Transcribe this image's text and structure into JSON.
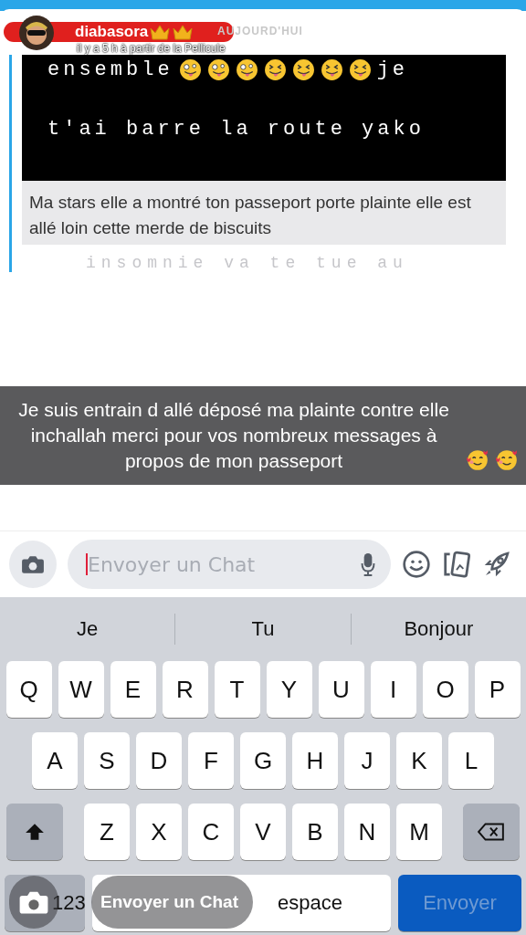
{
  "story_header": {
    "username": "diabasora",
    "date_label": "AUJOURD'HUI",
    "subtitle": "il y a 5 h à partir de la Pellicule"
  },
  "quoted_snap": {
    "line_1_start": "ensemble",
    "line_1_end": "je",
    "line_2": "t'ai barre la route yako",
    "caption": "Ma stars elle a montré ton passeport porte plainte elle est allé loin cette merde de biscuits",
    "faint_text": "insomnie va te tue au"
  },
  "banner": {
    "text": "Je suis entrain d allé déposé ma plainte contre elle inchallah merci pour vos nombreux messages à propos de mon passeport"
  },
  "chat_bar": {
    "placeholder": "Envoyer un Chat"
  },
  "keyboard": {
    "suggestions": [
      "Je",
      "Tu",
      "Bonjour"
    ],
    "rows": [
      [
        "Q",
        "W",
        "E",
        "R",
        "T",
        "Y",
        "U",
        "I",
        "O",
        "P"
      ],
      [
        "A",
        "S",
        "D",
        "F",
        "G",
        "H",
        "J",
        "K",
        "L"
      ],
      [
        "Z",
        "X",
        "C",
        "V",
        "B",
        "N",
        "M"
      ]
    ],
    "numbers_key": "123",
    "space_key": "espace",
    "send_key": "Envoyer"
  },
  "overlay": {
    "label": "Envoyer un Chat"
  }
}
